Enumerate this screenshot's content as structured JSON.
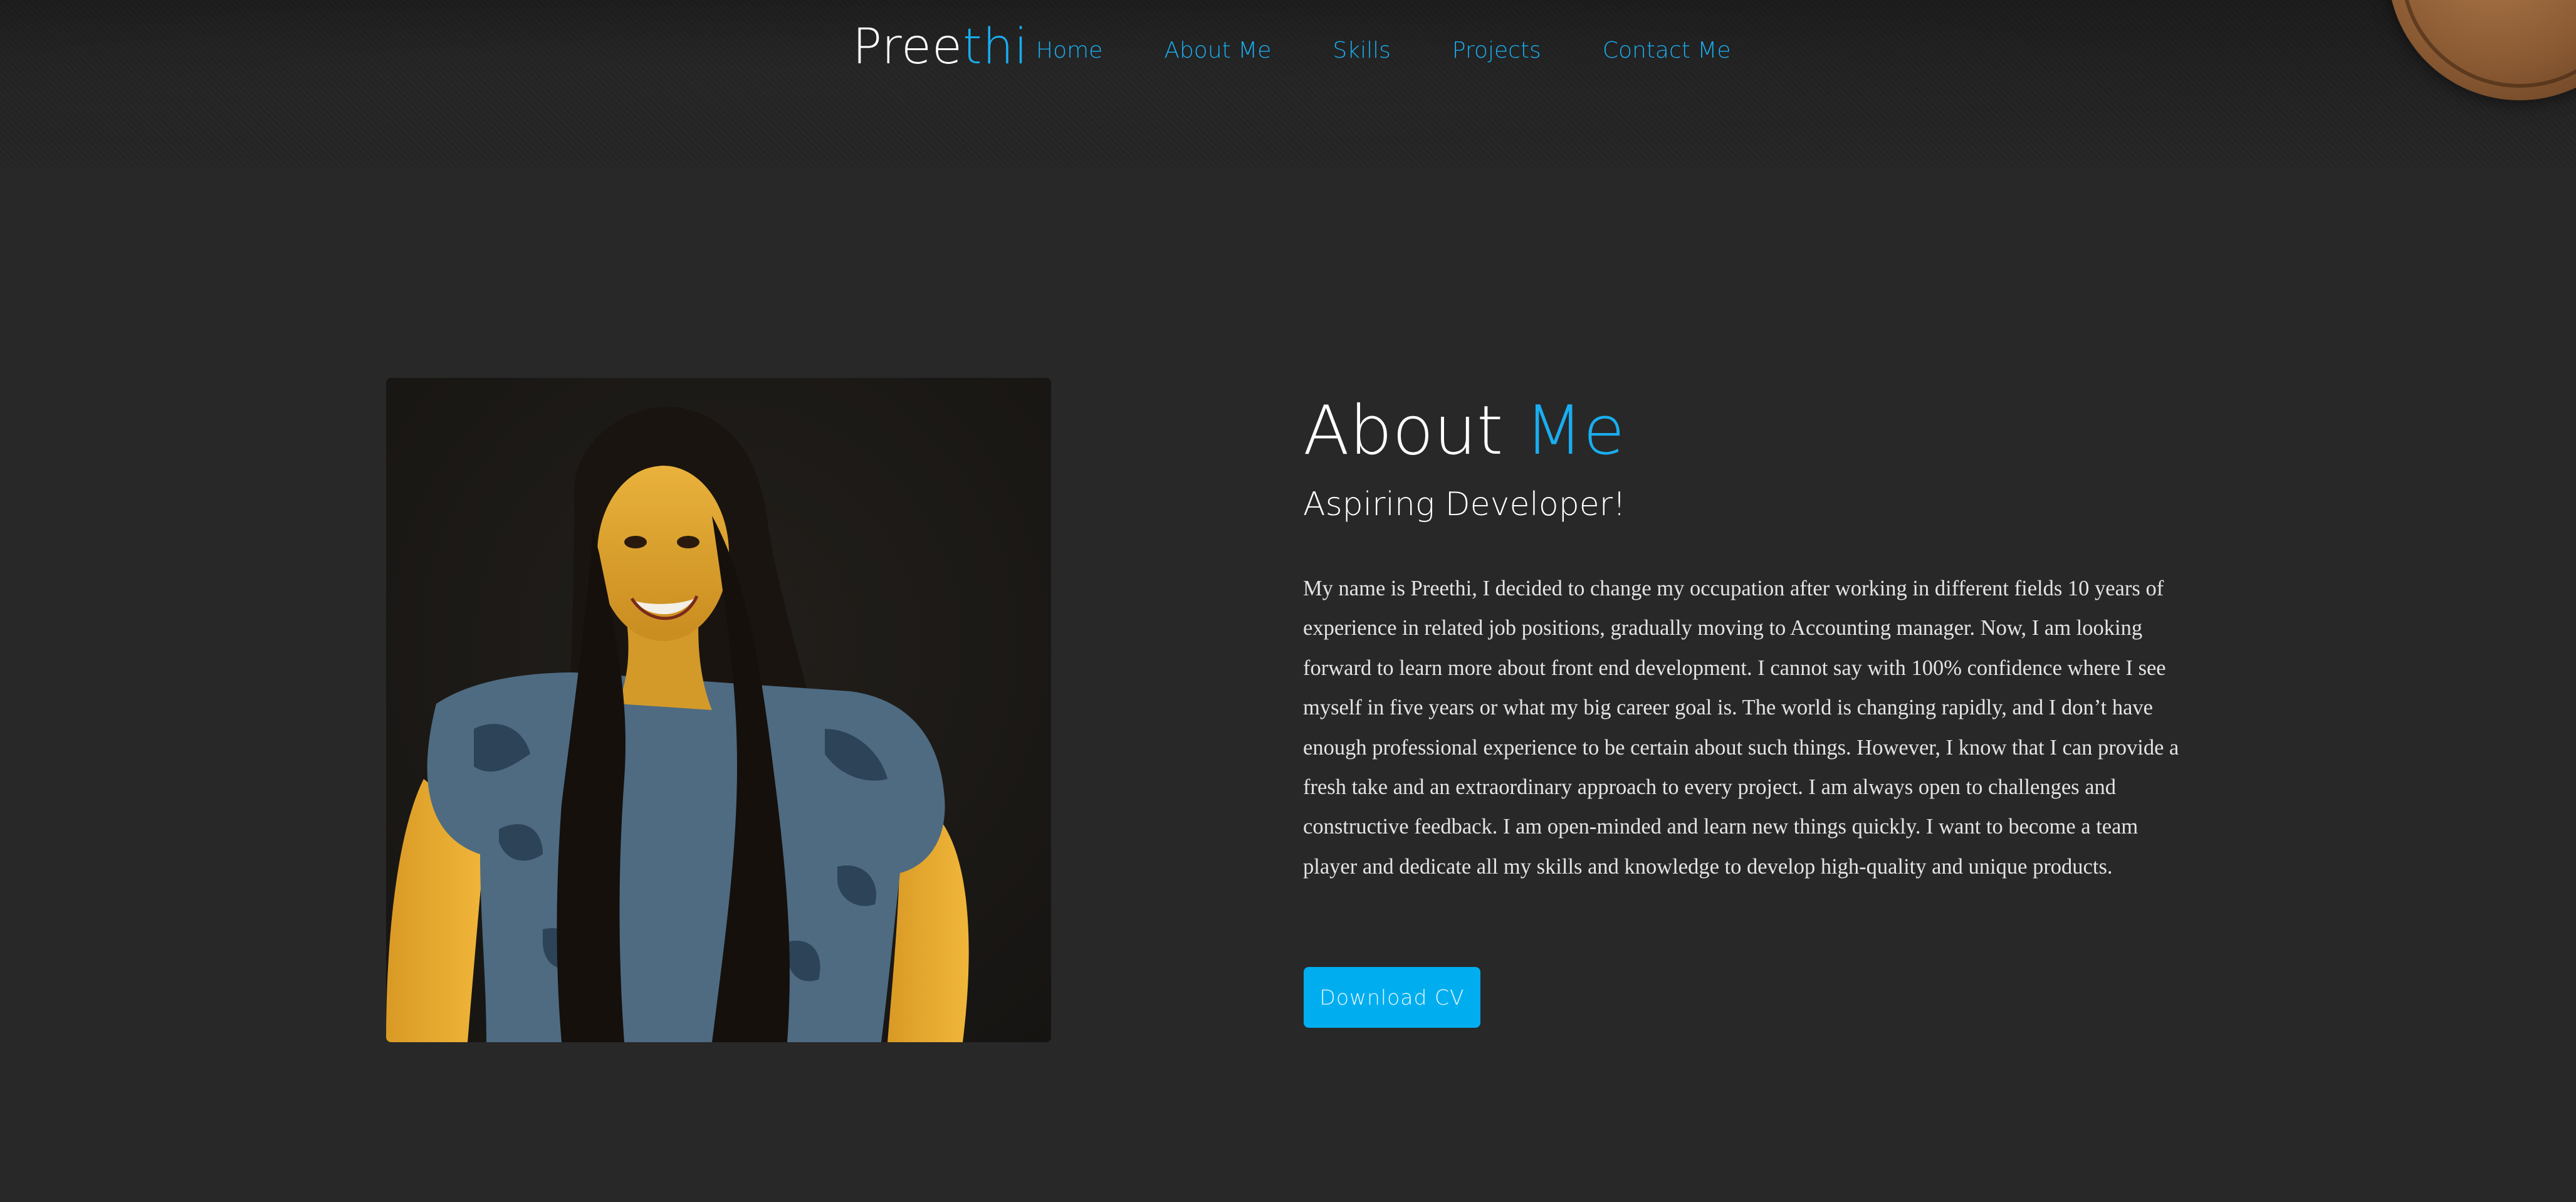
{
  "header": {
    "brand_part1": "Pree",
    "brand_part2": "thi",
    "nav": [
      {
        "label": "Home"
      },
      {
        "label": "About Me"
      },
      {
        "label": "Skills"
      },
      {
        "label": "Projects"
      },
      {
        "label": "Contact Me"
      }
    ]
  },
  "about": {
    "title_part1": "About",
    "title_part2": "Me",
    "subtitle": "Aspiring Developer!",
    "bio": "My name is Preethi, I decided to change my occupation after working in different fields 10 years of experience in related job positions, gradually moving to Accounting manager. Now, I am looking forward to learn more about front end development. I cannot say with 100% confidence where I see myself in five years or what my big career goal is. The world is changing rapidly, and I don’t have enough professional experience to be certain about such things. However, I know that I can provide a fresh take and an extraordinary approach to every project. I am always open to challenges and constructive feedback. I am open-minded and learn new things quickly. I want to become a team player and dedicate all my skills and knowledge to develop high-quality and unique products.",
    "cv_button_label": "Download CV"
  },
  "colors": {
    "accent": "#19aef0",
    "background": "#282828",
    "header_background": "#1e1e1e",
    "button": "#00aef0",
    "text": "#ffffff"
  }
}
